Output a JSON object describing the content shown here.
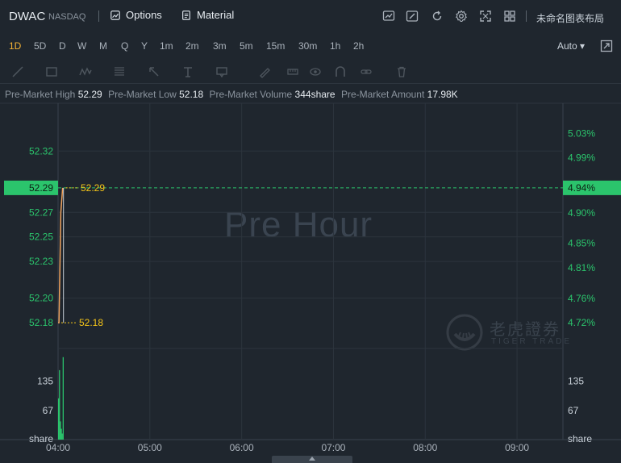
{
  "header": {
    "ticker": "DWAC",
    "exchange": "NASDAQ",
    "options_label": "Options",
    "material_label": "Material",
    "layout_name": "未命名图表布局",
    "icons": [
      "chart-type-icon",
      "draw-pen-icon",
      "refresh-icon",
      "settings-icon",
      "expand-icon",
      "grid-layout-icon"
    ]
  },
  "periods": {
    "items": [
      "1D",
      "5D",
      "D",
      "W",
      "M",
      "Q",
      "Y",
      "1m",
      "2m",
      "3m",
      "5m",
      "15m",
      "30m",
      "1h",
      "2h"
    ],
    "active": "1D",
    "scale_label": "Auto ▾"
  },
  "stats": {
    "high_label": "Pre-Market High",
    "high_value": "52.29",
    "low_label": "Pre-Market Low",
    "low_value": "52.18",
    "volume_label": "Pre-Market Volume",
    "volume_value": "344share",
    "amount_label": "Pre-Market Amount",
    "amount_value": "17.98K"
  },
  "watermark": {
    "session": "Pre Hour",
    "brand_cn": "老虎證券",
    "brand_en": "TIGER TRADE"
  },
  "colors": {
    "background": "#1f262e",
    "grid": "#2c343d",
    "up": "#2bc46c",
    "price_line": "#f0a35e",
    "marker": "#f5c518"
  },
  "chart_data": {
    "type": "line",
    "x_ticks": [
      "04:00",
      "05:00",
      "06:00",
      "07:00",
      "08:00",
      "09:00"
    ],
    "x_range_hours": [
      4.0,
      9.5
    ],
    "price_ticks": [
      "52.32",
      "52.27",
      "52.25",
      "52.23",
      "52.20",
      "52.18"
    ],
    "pct_ticks": [
      "5.03%",
      "4.99%",
      "4.94%",
      "4.90%",
      "4.85%",
      "4.81%",
      "4.76%",
      "4.72%"
    ],
    "ylim": [
      52.159,
      52.359
    ],
    "current_price": "52.29",
    "current_pct": "4.94%",
    "high_marker": "52.29",
    "low_marker": "52.18",
    "series": [
      {
        "x": [
          4.0,
          4.01,
          4.03,
          4.05
        ],
        "y": [
          52.18,
          52.18,
          52.27,
          52.29
        ]
      }
    ],
    "volume": {
      "ticks": [
        "135",
        "67"
      ],
      "unit_label": "share",
      "ylim": [
        0,
        210
      ],
      "x": [
        4.0,
        4.01,
        4.02,
        4.03,
        4.04,
        4.05
      ],
      "values": [
        95,
        160,
        42,
        25,
        14,
        190
      ]
    }
  }
}
